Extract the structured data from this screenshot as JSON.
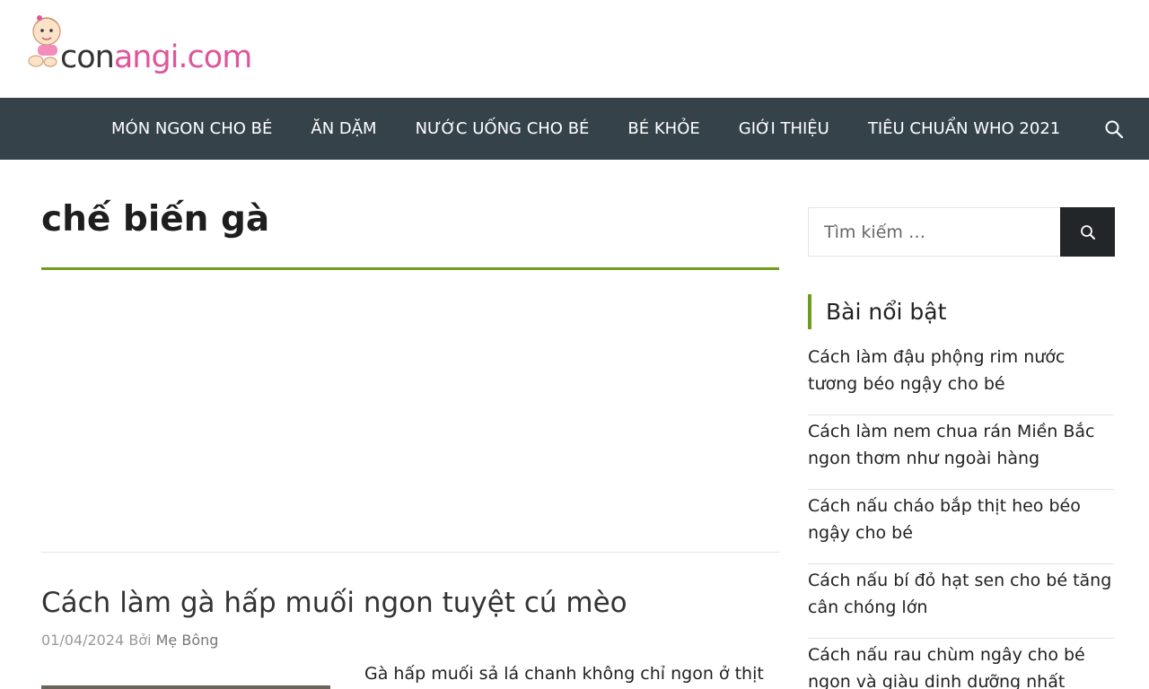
{
  "logo": {
    "part_con": "con",
    "part_angi": "angi",
    "part_com": ".com"
  },
  "nav": {
    "items": [
      {
        "label": "MÓN NGON CHO BÉ"
      },
      {
        "label": "ĂN DẶM"
      },
      {
        "label": "NƯỚC UỐNG CHO BÉ"
      },
      {
        "label": "BÉ KHỎE"
      },
      {
        "label": "GIỚI THIỆU"
      },
      {
        "label": "TIÊU CHUẨN WHO 2021"
      }
    ],
    "search_icon": "search-icon"
  },
  "archive": {
    "title": "chế biến gà"
  },
  "post": {
    "title": "Cách làm gà hấp muối ngon tuyệt cú mèo",
    "date": "01/04/2024",
    "by": "Bởi",
    "author": "Mẹ Bông",
    "excerpt": "Gà hấp muối sả lá chanh không chỉ ngon ở thịt"
  },
  "sidebar": {
    "search_placeholder": "Tìm kiếm …",
    "search_icon": "search-icon",
    "widget_title": "Bài nổi bật",
    "featured": [
      {
        "line1": "Cách làm đậu phộng rim nước",
        "line2": "tương béo ngậy cho bé"
      },
      {
        "line1": "Cách làm nem chua rán Miền Bắc",
        "line2": "ngon thơm như ngoài hàng"
      },
      {
        "line1": "Cách nấu cháo bắp thịt heo béo",
        "line2": "ngậy cho bé"
      },
      {
        "line1": "Cách nấu bí đỏ hạt sen cho bé tăng",
        "line2": "cân chóng lớn"
      },
      {
        "line1": "Cách nấu rau chùm ngây cho bé",
        "line2": "ngon và giàu dinh dưỡng nhất"
      }
    ]
  },
  "colors": {
    "nav_bg": "#36424a",
    "accent_green": "#6d9d1d",
    "logo_pink": "#e0559a",
    "search_button": "#222628"
  }
}
